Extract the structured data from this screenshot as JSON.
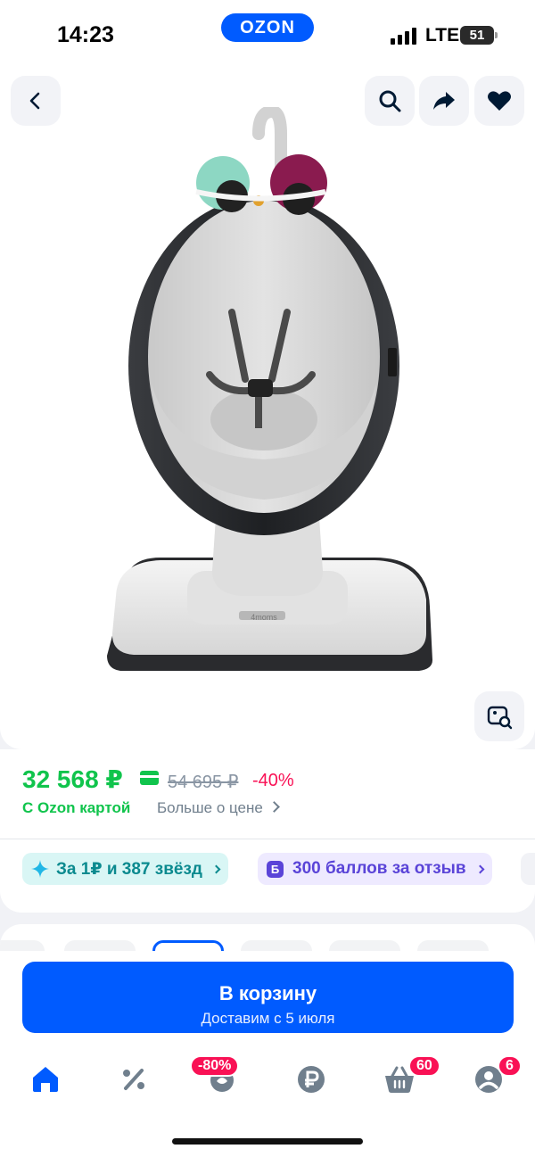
{
  "status_bar": {
    "time": "14:23",
    "logo": "OZON",
    "network": "LTE",
    "battery": "51"
  },
  "gallery": {
    "buttons": [
      "back-icon",
      "search-icon",
      "share-icon",
      "heart-icon",
      "image-search-icon"
    ],
    "product_brand_mark": "4moms"
  },
  "price": {
    "current": "32 568 ₽",
    "old": "54 695 ₽",
    "discount": "-40%",
    "card_label": "С Ozon картой",
    "more_label": "Больше о цене"
  },
  "chips": [
    {
      "label": "За 1₽ и 387 звёзд",
      "icon": "sparkle-icon"
    },
    {
      "label": "300 баллов за отзыв",
      "icon": "b-icon",
      "icon_text": "Б"
    }
  ],
  "cart_button": {
    "title": "В корзину",
    "subtitle": "Доставим с 5 июля"
  },
  "tabbar": {
    "tabs": [
      {
        "name": "home",
        "icon": "home-icon",
        "active": true
      },
      {
        "name": "sale",
        "icon": "percent-icon"
      },
      {
        "name": "fresh",
        "icon": "fresh-icon",
        "badge": "-80%"
      },
      {
        "name": "finance",
        "icon": "ruble-icon"
      },
      {
        "name": "cart",
        "icon": "basket-icon",
        "badge": "60"
      },
      {
        "name": "profile",
        "icon": "profile-icon",
        "badge": "6"
      }
    ]
  },
  "colors": {
    "brand": "#005bff",
    "price_green": "#10c44c",
    "discount_pink": "#f91155",
    "icon_gray": "#707f8d"
  }
}
